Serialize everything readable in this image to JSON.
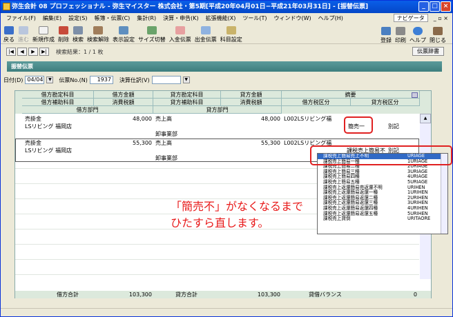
{
  "window": {
    "title": "弥生会計 08 プロフェッショナル - 弥生マイスター 株式会社・第5期[平成20年04月01日−平成21年03月31日] - [振替伝票]"
  },
  "menu": [
    "ファイル(F)",
    "編集(E)",
    "設定(S)",
    "帳簿・伝票(C)",
    "集計(R)",
    "決算・申告(K)",
    "拡張機能(X)",
    "ツール(T)",
    "ウィンドウ(W)",
    "ヘルプ(H)"
  ],
  "navi": {
    "label": "ナビゲータ"
  },
  "toolbar": {
    "left": [
      "戻る",
      "進む",
      "新規作成",
      "削除",
      "検索",
      "検索解除",
      "表示設定",
      "サイズ切替",
      "入金伝票",
      "出金伝票",
      "科目設定"
    ],
    "right": [
      "登録",
      "印刷",
      "ヘルプ",
      "閉じる"
    ]
  },
  "nav": {
    "results": "検索結果：1 / 1 枚",
    "dictionary": "伝票辞書"
  },
  "form": {
    "title": "振替伝票",
    "date_label": "日付(D)",
    "date_value": "04/04",
    "no_label": "伝票No.(N)",
    "no_value": "1937",
    "settle_label": "決算仕訳(V)"
  },
  "headers": {
    "r1": [
      "借方勘定科目",
      "借方金額",
      "貸方勘定科目",
      "貸方金額",
      "摘要"
    ],
    "r2": [
      "借方補助科目",
      "消費税額",
      "貸方補助科目",
      "消費税額",
      "借方税区分",
      "貸方税区分"
    ],
    "r3": [
      "借方部門",
      "貸方部門"
    ]
  },
  "entries": [
    {
      "debit_account": "売掛金",
      "debit_amount": "48,000",
      "credit_account": "売上高",
      "credit_amount": "48,000",
      "memo": "L002LSリビング福",
      "debit_sub": "LSリビング 福岡店",
      "tax_kbn": "簡売一",
      "tax_kbn2": "別記",
      "credit_dept": "卸事業部"
    },
    {
      "debit_account": "売掛金",
      "debit_amount": "55,300",
      "credit_account": "売上高",
      "credit_amount": "55,300",
      "memo": "L002LSリビング福",
      "debit_sub": "LSリビング 福岡店",
      "tax_kbn": "課税売上簡易不",
      "tax_kbn2": "別記",
      "credit_dept": "卸事業部"
    }
  ],
  "dropdown": [
    {
      "name": "課税売上簡易売上不明",
      "code": "URIAGE",
      "selected": true
    },
    {
      "name": "課税売上簡易一種",
      "code": "1URIAGE"
    },
    {
      "name": "課税売上簡易二種",
      "code": "2URIAGE"
    },
    {
      "name": "課税売上簡易三種",
      "code": "3URIAGE"
    },
    {
      "name": "課税売上簡易四種",
      "code": "4URIAGE"
    },
    {
      "name": "課税売上簡易五種",
      "code": "5URIAGE"
    },
    {
      "name": "課税売上返還簡易売返還不明",
      "code": "URIHEN"
    },
    {
      "name": "課税売上返還簡易返還一種",
      "code": "1URIHEN"
    },
    {
      "name": "課税売上返還簡易返還二種",
      "code": "2URIHEN"
    },
    {
      "name": "課税売上返還簡易返還三種",
      "code": "3URIHEN"
    },
    {
      "name": "課税売上返還簡易返還四種",
      "code": "4URIHEN"
    },
    {
      "name": "課税売上返還簡易返還五種",
      "code": "5URIHEN"
    },
    {
      "name": "課税売上貸倒",
      "code": "URITAORE"
    }
  ],
  "totals": {
    "debit_label": "借方合計",
    "debit_value": "103,300",
    "credit_label": "貸方合計",
    "credit_value": "103,300",
    "balance_label": "貸借バランス",
    "balance_value": "0"
  },
  "annotation": {
    "line1": "「簡売不」がなくなるまで",
    "line2": "ひたすら直します。"
  },
  "colors": {
    "title_bar": "#0a5ee8",
    "header_bg": "#dce9dc",
    "form_title": "#3d7e7e",
    "highlight": "#316ac5",
    "annotation": "#e81a1a"
  }
}
